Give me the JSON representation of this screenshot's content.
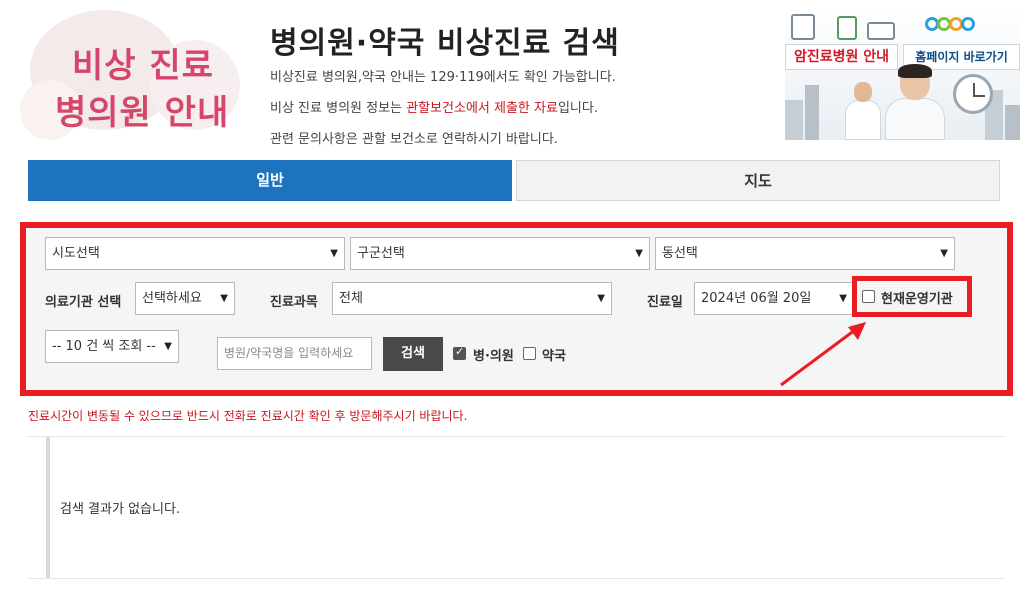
{
  "logo": {
    "line1": "비상 진료",
    "line2": "병의원 안내"
  },
  "header": {
    "title": "병의원·약국 비상진료 검색",
    "desc1": "비상진료 병의원,약국 안내는 129·119에서도 확인 가능합니다.",
    "desc2_pre": "비상 진료 병의원 정보는 ",
    "desc2_red": "관할보건소에서 제출한 자료",
    "desc2_post": "입니다.",
    "desc3": "관련 문의사항은 관할 보건소로 연락하시기 바랍니다."
  },
  "banner": {
    "cancer_label": "암진료병원 안내",
    "home_label": "홈페이지 바로가기"
  },
  "tabs": {
    "general": "일반",
    "map": "지도"
  },
  "search": {
    "sido": "시도선택",
    "gugun": "구군선택",
    "dong": "동선택",
    "inst_label": "의료기관 선택",
    "inst_value": "선택하세요",
    "dept_label": "진료과목",
    "dept_value": "전체",
    "date_label": "진료일",
    "date_value": "2024년 06월 20일",
    "open_now_label": "현재운영기관",
    "page_size": "-- 10 건 씩 조회 --",
    "name_placeholder": "병원/약국명을 입력하세요",
    "search_button": "검색",
    "hospital_label": "병·의원",
    "pharmacy_label": "약국",
    "hospital_checked": true,
    "pharmacy_checked": false,
    "open_now_checked": false
  },
  "notice": "진료시간이 변동될 수 있으므로 반드시 전화로 진료시간 확인 후 방문해주시기 바랍니다.",
  "results": {
    "empty_message": "검색 결과가 없습니다."
  },
  "colors": {
    "accent_blue": "#1e73be",
    "highlight_red": "#ea1c24",
    "notice_red": "#c8161e"
  }
}
